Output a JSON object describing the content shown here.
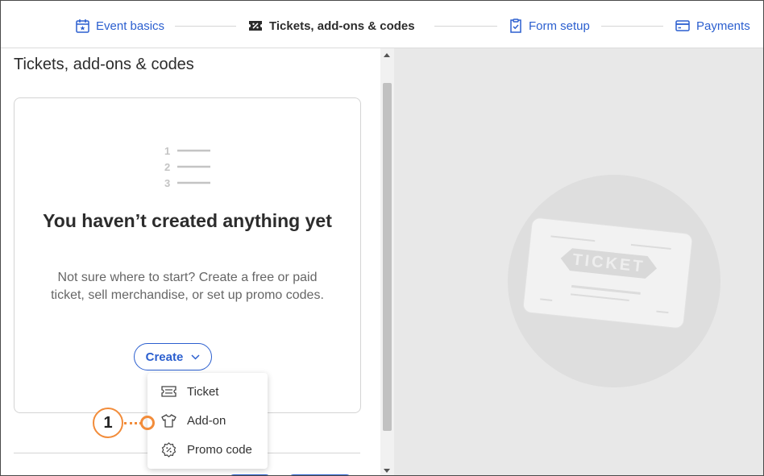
{
  "steps": [
    {
      "label": "Event basics",
      "icon": "calendar-icon",
      "active": false
    },
    {
      "label": "Tickets, add-ons & codes",
      "icon": "ticket-percent-icon",
      "active": true
    },
    {
      "label": "Form setup",
      "icon": "clipboard-check-icon",
      "active": false
    },
    {
      "label": "Payments",
      "icon": "credit-card-icon",
      "active": false
    }
  ],
  "section": {
    "title": "Tickets, add-ons & codes"
  },
  "empty_state": {
    "list_numbers": [
      "1",
      "2",
      "3"
    ],
    "title": "You haven’t created anything yet",
    "description": "Not sure where to start? Create a free or paid ticket, sell merchandise, or set up promo codes."
  },
  "create_button": {
    "label": "Create",
    "icon": "chevron-down-icon"
  },
  "dropdown": {
    "items": [
      {
        "label": "Ticket",
        "icon": "ticket-icon"
      },
      {
        "label": "Add-on",
        "icon": "tshirt-icon"
      },
      {
        "label": "Promo code",
        "icon": "promo-badge-icon"
      }
    ]
  },
  "callout": {
    "number": "1"
  },
  "preview": {
    "ticket_word": "TICKET"
  },
  "colors": {
    "accent": "#2b5fcf",
    "callout": "#f28c3a",
    "preview_bg": "#e8e8e8"
  }
}
